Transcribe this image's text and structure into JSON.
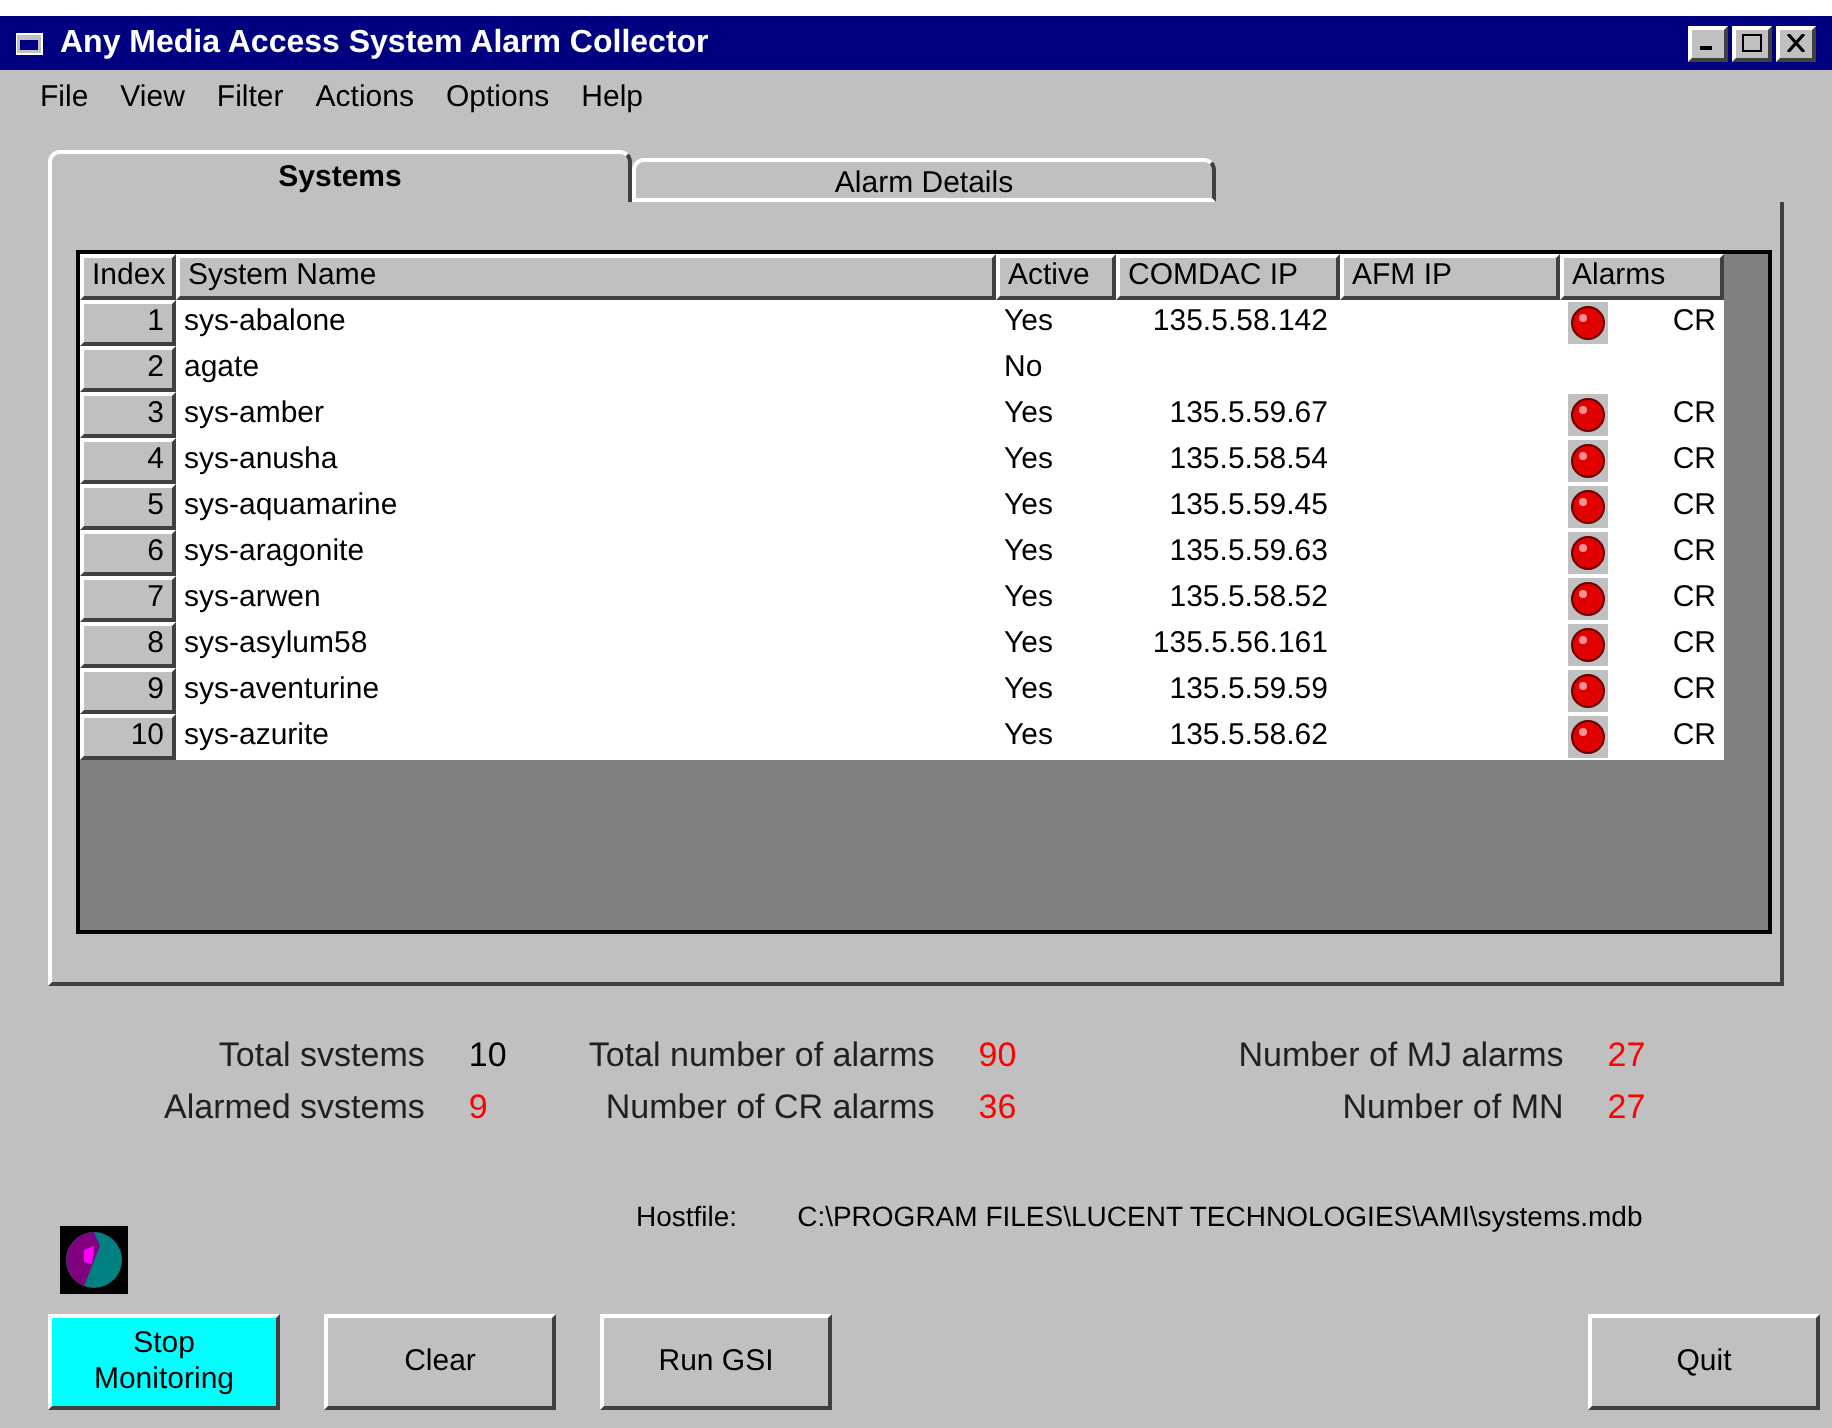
{
  "window": {
    "title": "Any Media Access System Alarm Collector"
  },
  "menu": [
    "File",
    "View",
    "Filter",
    "Actions",
    "Options",
    "Help"
  ],
  "tabs": [
    {
      "label": "Systems",
      "selected": true
    },
    {
      "label": "Alarm Details",
      "selected": false
    }
  ],
  "table": {
    "columns": [
      "Index",
      "System Name",
      "Active",
      "COMDAC IP",
      "AFM IP",
      "Alarms"
    ],
    "rows": [
      {
        "index": "1",
        "name": "sys-abalone",
        "active": "Yes",
        "comdac_ip": "135.5.58.142",
        "alarmed": true,
        "severity": "CR"
      },
      {
        "index": "2",
        "name": "agate",
        "active": "No",
        "alarmed": false
      },
      {
        "index": "3",
        "name": "sys-amber",
        "active": "Yes",
        "comdac_ip": "135.5.59.67",
        "alarmed": true,
        "severity": "CR"
      },
      {
        "index": "4",
        "name": "sys-anusha",
        "active": "Yes",
        "comdac_ip": "135.5.58.54",
        "alarmed": true,
        "severity": "CR"
      },
      {
        "index": "5",
        "name": "sys-aquamarine",
        "active": "Yes",
        "comdac_ip": "135.5.59.45",
        "alarmed": true,
        "severity": "CR"
      },
      {
        "index": "6",
        "name": "sys-aragonite",
        "active": "Yes",
        "comdac_ip": "135.5.59.63",
        "alarmed": true,
        "severity": "CR"
      },
      {
        "index": "7",
        "name": "sys-arwen",
        "active": "Yes",
        "comdac_ip": "135.5.58.52",
        "alarmed": true,
        "severity": "CR"
      },
      {
        "index": "8",
        "name": "sys-asylum58",
        "active": "Yes",
        "comdac_ip": "135.5.56.161",
        "alarmed": true,
        "severity": "CR"
      },
      {
        "index": "9",
        "name": "sys-aventurine",
        "active": "Yes",
        "comdac_ip": "135.5.59.59",
        "alarmed": true,
        "severity": "CR"
      },
      {
        "index": "10",
        "name": "sys-azurite",
        "active": "Yes",
        "comdac_ip": "135.5.58.62",
        "alarmed": true,
        "severity": "CR"
      }
    ]
  },
  "stats": [
    [
      {
        "label": "Total svstems",
        "value": "10",
        "color": "#000000"
      },
      {
        "label": "Alarmed svstems",
        "value": "9",
        "color": "#ff0000"
      }
    ],
    [
      {
        "label": "Total number of alarms",
        "value": "90",
        "color": "#ff0000"
      },
      {
        "label": "Number of CR alarms",
        "value": "36",
        "color": "#ff0000"
      }
    ],
    [
      {
        "label": "Number of MJ alarms",
        "value": "27",
        "color": "#ff0000"
      },
      {
        "label": "Number of MN",
        "value": "27",
        "color": "#ff0000"
      }
    ]
  ],
  "hostfile": {
    "label": "Hostfile:",
    "path": "C:\\PROGRAM FILES\\LUCENT TECHNOLOGIES\\AMI\\systems.mdb"
  },
  "buttons": [
    {
      "label": "Stop Monitoring",
      "active": true
    },
    {
      "label": "Clear",
      "active": false
    },
    {
      "label": "Run GSI",
      "active": false
    },
    {
      "label": "Quit",
      "active": false
    }
  ]
}
